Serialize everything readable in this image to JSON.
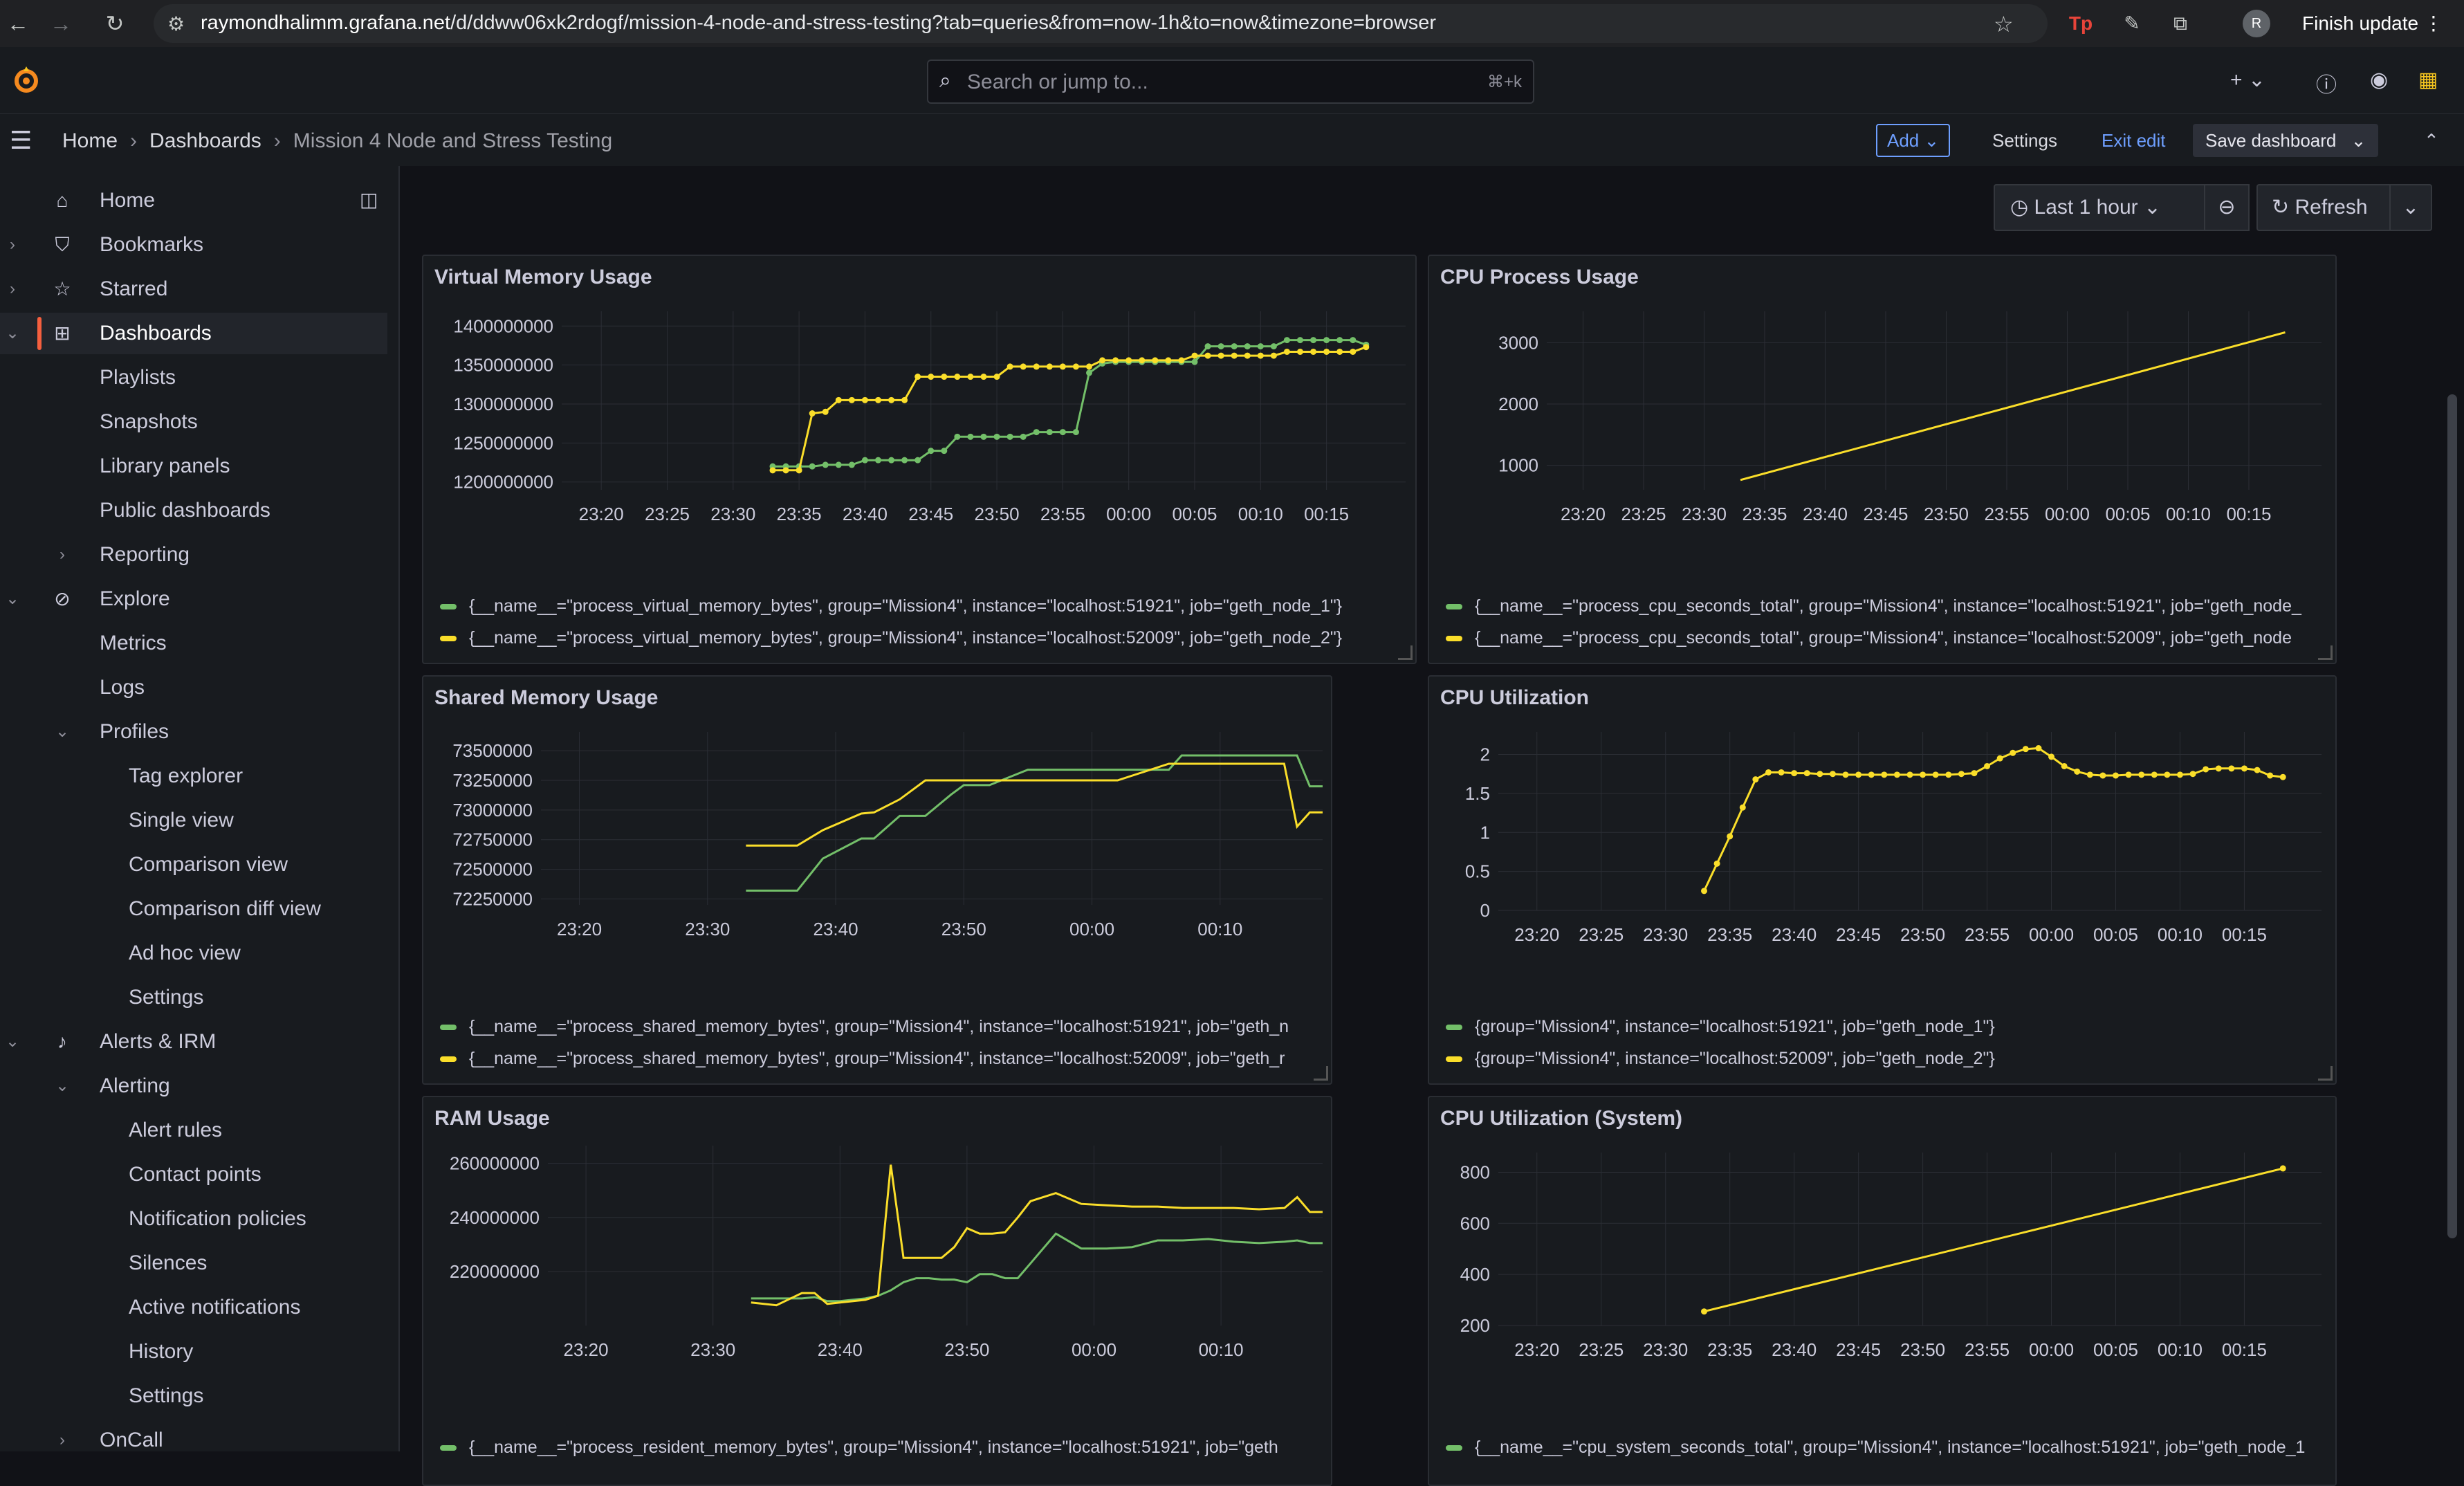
{
  "browser": {
    "url_host": "raymondhalimm.grafana.net",
    "url_path": "/d/ddww06xk2rdogf/mission-4-node-and-stress-testing?tab=queries&from=now-1h&to=now&timezone=browser",
    "profile_initial": "R",
    "finish_update": "Finish update"
  },
  "topbar": {
    "search_placeholder": "Search or jump to...",
    "search_shortcut": "⌘+k"
  },
  "breadcrumb": [
    "Home",
    "Dashboards",
    "Mission 4 Node and Stress Testing"
  ],
  "toolbar": {
    "add": "Add",
    "settings": "Settings",
    "exit_edit": "Exit edit",
    "save": "Save dashboard"
  },
  "sidebar": {
    "items": [
      {
        "label": "Home",
        "icon": "home-icon",
        "level": 0
      },
      {
        "label": "Bookmarks",
        "icon": "bookmark-icon",
        "level": 0,
        "chevron": "›"
      },
      {
        "label": "Starred",
        "icon": "star-icon",
        "level": 0,
        "chevron": "›"
      },
      {
        "label": "Dashboards",
        "icon": "apps-icon",
        "level": 0,
        "chevron": "⌄",
        "active": true
      },
      {
        "label": "Playlists",
        "level": 1
      },
      {
        "label": "Snapshots",
        "level": 1
      },
      {
        "label": "Library panels",
        "level": 1
      },
      {
        "label": "Public dashboards",
        "level": 1
      },
      {
        "label": "Reporting",
        "level": 1,
        "chevron": "›"
      },
      {
        "label": "Explore",
        "icon": "compass-icon",
        "level": 0,
        "chevron": "⌄"
      },
      {
        "label": "Metrics",
        "level": 1
      },
      {
        "label": "Logs",
        "level": 1
      },
      {
        "label": "Profiles",
        "level": 1,
        "chevron": "⌄"
      },
      {
        "label": "Tag explorer",
        "level": 2
      },
      {
        "label": "Single view",
        "level": 2
      },
      {
        "label": "Comparison view",
        "level": 2
      },
      {
        "label": "Comparison diff view",
        "level": 2
      },
      {
        "label": "Ad hoc view",
        "level": 2
      },
      {
        "label": "Settings",
        "level": 2
      },
      {
        "label": "Alerts & IRM",
        "icon": "bell-icon",
        "level": 0,
        "chevron": "⌄"
      },
      {
        "label": "Alerting",
        "level": 1,
        "chevron": "⌄"
      },
      {
        "label": "Alert rules",
        "level": 2
      },
      {
        "label": "Contact points",
        "level": 2
      },
      {
        "label": "Notification policies",
        "level": 2
      },
      {
        "label": "Silences",
        "level": 2
      },
      {
        "label": "Active notifications",
        "level": 2
      },
      {
        "label": "History",
        "level": 2
      },
      {
        "label": "Settings",
        "level": 2
      },
      {
        "label": "OnCall",
        "level": 1,
        "chevron": "›"
      }
    ]
  },
  "timepicker": {
    "range": "Last 1 hour",
    "refresh": "Refresh"
  },
  "colors": {
    "series_green": "#73bf69",
    "series_yellow": "#fade2a",
    "accent": "#f55f3e",
    "link": "#6e9fff"
  },
  "panels": [
    {
      "title": "Virtual Memory Usage",
      "legend": [
        "{__name__=\"process_virtual_memory_bytes\", group=\"Mission4\", instance=\"localhost:51921\", job=\"geth_node_1\"}",
        "{__name__=\"process_virtual_memory_bytes\", group=\"Mission4\", instance=\"localhost:52009\", job=\"geth_node_2\"}"
      ]
    },
    {
      "title": "CPU Process Usage",
      "legend": [
        "{__name__=\"process_cpu_seconds_total\", group=\"Mission4\", instance=\"localhost:51921\", job=\"geth_node_",
        "{__name__=\"process_cpu_seconds_total\", group=\"Mission4\", instance=\"localhost:52009\", job=\"geth_node"
      ]
    },
    {
      "title": "Shared Memory Usage",
      "legend": [
        "{__name__=\"process_shared_memory_bytes\", group=\"Mission4\", instance=\"localhost:51921\", job=\"geth_n",
        "{__name__=\"process_shared_memory_bytes\", group=\"Mission4\", instance=\"localhost:52009\", job=\"geth_r"
      ]
    },
    {
      "title": "CPU Utilization",
      "legend": [
        "{group=\"Mission4\", instance=\"localhost:51921\", job=\"geth_node_1\"}",
        "{group=\"Mission4\", instance=\"localhost:52009\", job=\"geth_node_2\"}"
      ]
    },
    {
      "title": "RAM Usage",
      "legend": [
        "{__name__=\"process_resident_memory_bytes\", group=\"Mission4\", instance=\"localhost:51921\", job=\"geth"
      ]
    },
    {
      "title": "CPU Utilization (System)",
      "legend": [
        "{__name__=\"cpu_system_seconds_total\", group=\"Mission4\", instance=\"localhost:51921\", job=\"geth_node_1"
      ]
    }
  ],
  "chart_data": [
    {
      "type": "line",
      "title": "Virtual Memory Usage",
      "x": [
        "23:33",
        "23:34",
        "23:35",
        "23:36",
        "23:37",
        "23:38",
        "23:39",
        "23:40",
        "23:41",
        "23:42",
        "23:43",
        "23:44",
        "23:45",
        "23:46",
        "23:47",
        "23:48",
        "23:49",
        "23:50",
        "23:51",
        "23:52",
        "23:53",
        "23:54",
        "23:55",
        "23:56",
        "23:57",
        "23:58",
        "23:59",
        "00:00",
        "00:01",
        "00:02",
        "00:03",
        "00:04",
        "00:05",
        "00:06",
        "00:07",
        "00:08",
        "00:09",
        "00:10",
        "00:11",
        "00:12",
        "00:13",
        "00:14",
        "00:15",
        "00:16",
        "00:17",
        "00:18"
      ],
      "series": [
        {
          "name": "{__name__=\"process_virtual_memory_bytes\", group=\"Mission4\", instance=\"localhost:51921\", job=\"geth_node_1\"}",
          "color": "#73bf69",
          "values": [
            1220000000,
            1220000000,
            1220000000,
            1220000000,
            1222000000,
            1222000000,
            1222000000,
            1228000000,
            1228000000,
            1228000000,
            1228000000,
            1228000000,
            1240000000,
            1240000000,
            1258000000,
            1258000000,
            1258000000,
            1258000000,
            1258000000,
            1258000000,
            1264000000,
            1264000000,
            1264000000,
            1264000000,
            1340000000,
            1352000000,
            1354000000,
            1354000000,
            1354000000,
            1354000000,
            1354000000,
            1354000000,
            1354000000,
            1374000000,
            1374000000,
            1374000000,
            1374000000,
            1374000000,
            1374000000,
            1382000000,
            1382000000,
            1382000000,
            1382000000,
            1382000000,
            1382000000,
            1376000000
          ]
        },
        {
          "name": "{__name__=\"process_virtual_memory_bytes\", group=\"Mission4\", instance=\"localhost:52009\", job=\"geth_node_2\"}",
          "color": "#fade2a",
          "values": [
            1215000000,
            1215000000,
            1215000000,
            1288000000,
            1290000000,
            1305000000,
            1305000000,
            1305000000,
            1305000000,
            1305000000,
            1305000000,
            1335000000,
            1335000000,
            1335000000,
            1335000000,
            1335000000,
            1335000000,
            1335000000,
            1348000000,
            1348000000,
            1348000000,
            1348000000,
            1348000000,
            1348000000,
            1348000000,
            1356000000,
            1356000000,
            1356000000,
            1356000000,
            1356000000,
            1356000000,
            1356000000,
            1362000000,
            1362000000,
            1362000000,
            1362000000,
            1362000000,
            1362000000,
            1362000000,
            1367000000,
            1367000000,
            1367000000,
            1367000000,
            1367000000,
            1367000000,
            1373000000
          ]
        }
      ],
      "xlim": [
        "23:17",
        "00:21"
      ],
      "ylim": [
        1190000000,
        1410000000
      ],
      "yticks": [
        1200000000,
        1250000000,
        1300000000,
        1350000000,
        1400000000
      ],
      "xticks": [
        "23:20",
        "23:25",
        "23:30",
        "23:35",
        "23:40",
        "23:45",
        "23:50",
        "23:55",
        "00:00",
        "00:05",
        "00:10",
        "00:15"
      ]
    },
    {
      "type": "line",
      "title": "CPU Process Usage",
      "x": [
        "23:33",
        "00:18"
      ],
      "series": [
        {
          "name": "{__name__=\"process_cpu_seconds_total\", group=\"Mission4\", instance=\"localhost:52009\", job=\"geth_node",
          "color": "#fade2a",
          "values": [
            760,
            3170
          ]
        }
      ],
      "xlim": [
        "23:17",
        "00:21"
      ],
      "ylim": [
        600,
        3400
      ],
      "yticks": [
        1000,
        2000,
        3000
      ],
      "xticks": [
        "23:20",
        "23:25",
        "23:30",
        "23:35",
        "23:40",
        "23:45",
        "23:50",
        "23:55",
        "00:00",
        "00:05",
        "00:10",
        "00:15"
      ]
    },
    {
      "type": "line",
      "title": "Shared Memory Usage",
      "x": [
        "23:33",
        "23:37",
        "23:39",
        "23:42",
        "23:43",
        "23:45",
        "23:47",
        "23:49",
        "23:50",
        "23:52",
        "23:55",
        "23:56",
        "00:00",
        "00:02",
        "00:06",
        "00:07",
        "00:12",
        "00:15",
        "00:16",
        "00:17",
        "00:18"
      ],
      "series": [
        {
          "name": "{__name__=\"process_shared_memory_bytes\", group=\"Mission4\", instance=\"localhost:51921\", job=\"geth_n",
          "color": "#73bf69",
          "values": [
            72320000,
            72320000,
            72590000,
            72760000,
            72760000,
            72950000,
            72950000,
            73130000,
            73210000,
            73210000,
            73340000,
            73340000,
            73340000,
            73340000,
            73340000,
            73460000,
            73460000,
            73460000,
            73460000,
            73200000,
            73200000
          ]
        },
        {
          "name": "{__name__=\"process_shared_memory_bytes\", group=\"Mission4\", instance=\"localhost:52009\", job=\"geth_r",
          "color": "#fade2a",
          "values": [
            72700000,
            72700000,
            72830000,
            72970000,
            72980000,
            73090000,
            73250000,
            73250000,
            73250000,
            73250000,
            73250000,
            73250000,
            73250000,
            73250000,
            73390000,
            73390000,
            73390000,
            73390000,
            72860000,
            72980000,
            72980000
          ]
        }
      ],
      "xlim": [
        "23:17",
        "00:18"
      ],
      "ylim": [
        72200000,
        73600000
      ],
      "yticks": [
        72250000,
        72500000,
        72750000,
        73000000,
        73250000,
        73500000
      ],
      "xticks": [
        "23:20",
        "23:30",
        "23:40",
        "23:50",
        "00:00",
        "00:10"
      ]
    },
    {
      "type": "line",
      "title": "CPU Utilization",
      "x": [
        "23:33",
        "23:34",
        "23:35",
        "23:36",
        "23:37",
        "23:38",
        "23:39",
        "23:40",
        "23:41",
        "23:42",
        "23:43",
        "23:44",
        "23:45",
        "23:46",
        "23:47",
        "23:48",
        "23:49",
        "23:50",
        "23:51",
        "23:52",
        "23:53",
        "23:54",
        "23:55",
        "23:56",
        "23:57",
        "23:58",
        "23:59",
        "00:00",
        "00:01",
        "00:02",
        "00:03",
        "00:04",
        "00:05",
        "00:06",
        "00:07",
        "00:08",
        "00:09",
        "00:10",
        "00:11",
        "00:12",
        "00:13",
        "00:14",
        "00:15",
        "00:16",
        "00:17",
        "00:18"
      ],
      "series": [
        {
          "name": "{group=\"Mission4\", instance=\"localhost:52009\", job=\"geth_node_2\"}",
          "color": "#fade2a",
          "values": [
            0.25,
            0.6,
            0.95,
            1.32,
            1.68,
            1.77,
            1.77,
            1.76,
            1.76,
            1.75,
            1.75,
            1.74,
            1.74,
            1.74,
            1.74,
            1.74,
            1.74,
            1.74,
            1.74,
            1.74,
            1.75,
            1.76,
            1.85,
            1.95,
            2.02,
            2.07,
            2.08,
            1.97,
            1.85,
            1.78,
            1.74,
            1.73,
            1.73,
            1.74,
            1.74,
            1.74,
            1.74,
            1.74,
            1.75,
            1.81,
            1.82,
            1.82,
            1.82,
            1.8,
            1.73,
            1.71
          ]
        }
      ],
      "xlim": [
        "23:17",
        "00:21"
      ],
      "ylim": [
        0,
        2.2
      ],
      "yticks": [
        0,
        0.5,
        1,
        1.5,
        2
      ],
      "xticks": [
        "23:20",
        "23:25",
        "23:30",
        "23:35",
        "23:40",
        "23:45",
        "23:50",
        "23:55",
        "00:00",
        "00:05",
        "00:10",
        "00:15"
      ]
    },
    {
      "type": "line",
      "title": "RAM Usage",
      "x": [
        "23:33",
        "23:35",
        "23:37",
        "23:38",
        "23:39",
        "23:40",
        "23:42",
        "23:43",
        "23:44",
        "23:45",
        "23:46",
        "23:47",
        "23:48",
        "23:49",
        "23:50",
        "23:51",
        "23:52",
        "23:53",
        "23:54",
        "23:55",
        "23:57",
        "23:59",
        "00:01",
        "00:03",
        "00:05",
        "00:07",
        "00:09",
        "00:11",
        "00:13",
        "00:15",
        "00:16",
        "00:17",
        "00:18"
      ],
      "series": [
        {
          "name": "{__name__=\"process_resident_memory_bytes\", group=\"Mission4\", instance=\"localhost:51921\", job=\"geth",
          "color": "#73bf69",
          "values": [
            210000000,
            210000000,
            210000000,
            210500000,
            209000000,
            209000000,
            210000000,
            211000000,
            213000000,
            216000000,
            217500000,
            217500000,
            217000000,
            217000000,
            216000000,
            219000000,
            219000000,
            217500000,
            217500000,
            223000000,
            234000000,
            228500000,
            228500000,
            229000000,
            231500000,
            231500000,
            232000000,
            231000000,
            230500000,
            231000000,
            231500000,
            230500000,
            230500000
          ]
        },
        {
          "name": "",
          "color": "#fade2a",
          "values": [
            208500000,
            207500000,
            212000000,
            212000000,
            208000000,
            208500000,
            209500000,
            211000000,
            259500000,
            225000000,
            225000000,
            225000000,
            225000000,
            229000000,
            236000000,
            234000000,
            234000000,
            234500000,
            240000000,
            246000000,
            249000000,
            245000000,
            244500000,
            244000000,
            244000000,
            243500000,
            243500000,
            243500000,
            243000000,
            243500000,
            247500000,
            242000000,
            242000000
          ]
        }
      ],
      "xlim": [
        "23:17",
        "00:18"
      ],
      "ylim": [
        200000000,
        264000000
      ],
      "yticks": [
        220000000,
        240000000,
        260000000
      ],
      "xticks": [
        "23:20",
        "23:30",
        "23:40",
        "23:50",
        "00:00",
        "00:10"
      ]
    },
    {
      "type": "line",
      "title": "CPU Utilization (System)",
      "x": [
        "23:33",
        "00:18"
      ],
      "series": [
        {
          "name": "{__name__=\"cpu_system_seconds_total\", group=\"Mission4\", instance=\"localhost:51921\", job=\"geth_node_1",
          "color": "#fade2a",
          "values": [
            255,
            815
          ]
        }
      ],
      "xlim": [
        "23:17",
        "00:21"
      ],
      "ylim": [
        200,
        850
      ],
      "yticks": [
        200,
        400,
        600,
        800
      ],
      "xticks": [
        "23:20",
        "23:25",
        "23:30",
        "23:35",
        "23:40",
        "23:45",
        "23:50",
        "23:55",
        "00:00",
        "00:05",
        "00:10",
        "00:15"
      ]
    }
  ]
}
